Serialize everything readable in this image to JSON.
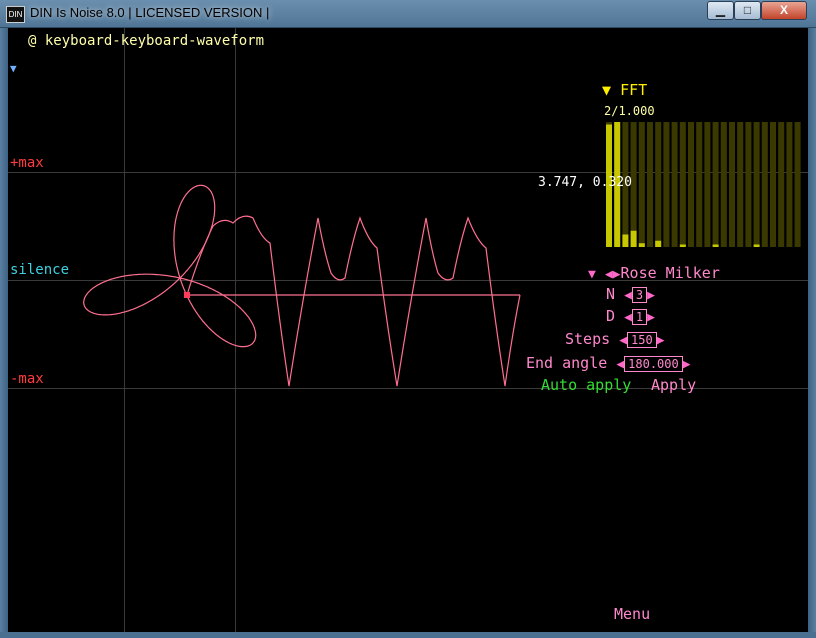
{
  "window": {
    "title": "DIN Is Noise 8.0 | LICENSED VERSION |",
    "icon_text": "DIN",
    "buttons": {
      "minimize": "▁",
      "maximize": "□",
      "close": "X"
    }
  },
  "editor": {
    "instrument_label": "@ keyboard-keyboard-waveform",
    "collapse_arrow": "▼",
    "labels": {
      "max": "+max",
      "silence": "silence",
      "min": "-max"
    },
    "coordinate_readout": "3.747, 0.320"
  },
  "fft": {
    "title": "FFT",
    "arrow": "▼",
    "caption": "2/1.000",
    "bars": [
      0.98,
      1.0,
      0.1,
      0.13,
      0.03,
      0.0,
      0.05,
      0.0,
      0.0,
      0.02,
      0.0,
      0.0,
      0.0,
      0.02,
      0.0,
      0.0,
      0.0,
      0.0,
      0.02,
      0.0,
      0.0,
      0.0,
      0.0,
      0.0
    ],
    "active_color": "#c8c800",
    "inactive_color": "#3a3a00"
  },
  "rose_milker": {
    "title": "Rose Milker",
    "fields": [
      {
        "label": "N",
        "value": "3"
      },
      {
        "label": "D",
        "value": "1"
      },
      {
        "label": "Steps",
        "value": "150"
      },
      {
        "label": "End angle",
        "value": "180.000"
      }
    ],
    "auto_apply": "Auto apply",
    "apply": "Apply"
  },
  "menu": {
    "label": "Menu"
  },
  "colors": {
    "curve": "#ff6f8f",
    "grid": "#3a3a3a",
    "selected_point": "#ff3b5b"
  }
}
